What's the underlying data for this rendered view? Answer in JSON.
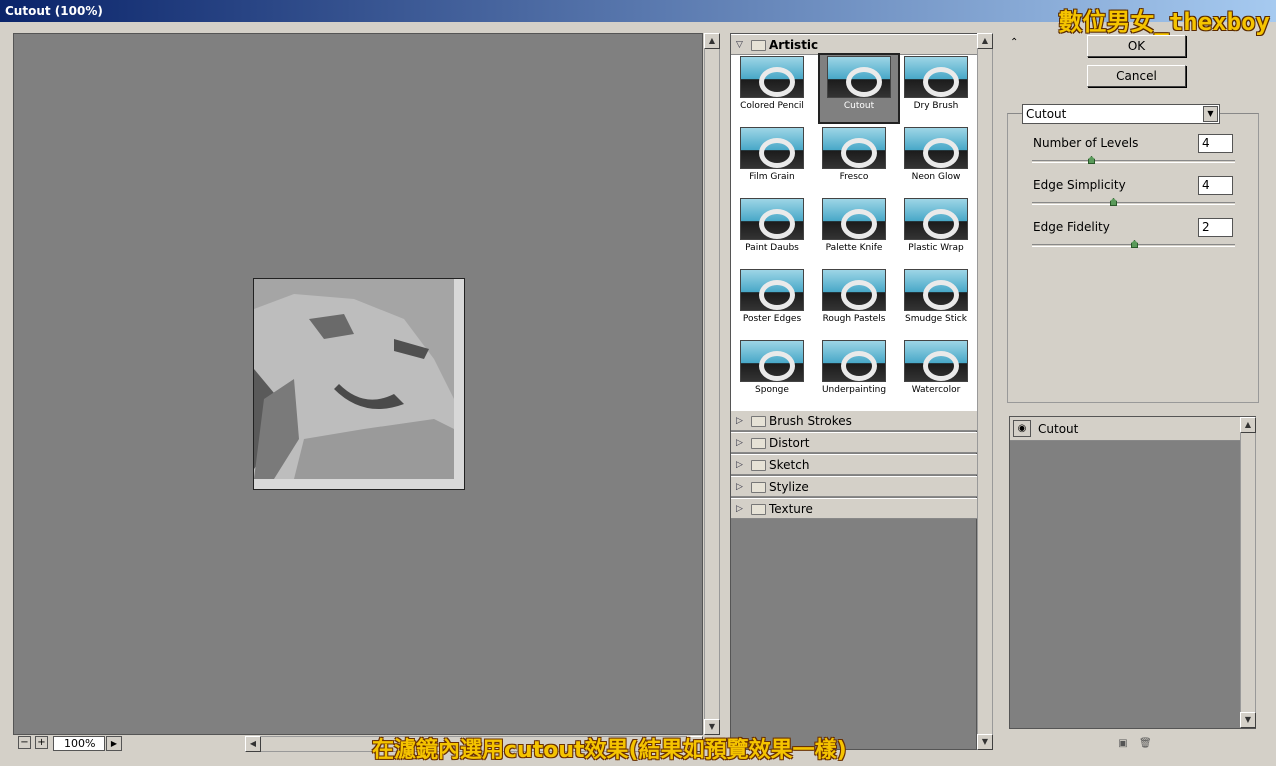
{
  "window": {
    "title": "Cutout (100%)"
  },
  "watermark": "數位男女_thexboy",
  "caption": "在濾鏡內選用cutout效果(結果如預覽效果一樣)",
  "preview": {
    "zoom": "100%",
    "zoom_out": "−",
    "zoom_in": "+"
  },
  "gallery": {
    "open_category": "Artistic",
    "filters": [
      {
        "label": "Colored Pencil"
      },
      {
        "label": "Cutout",
        "selected": true
      },
      {
        "label": "Dry Brush"
      },
      {
        "label": "Film Grain"
      },
      {
        "label": "Fresco"
      },
      {
        "label": "Neon Glow"
      },
      {
        "label": "Paint Daubs"
      },
      {
        "label": "Palette Knife"
      },
      {
        "label": "Plastic Wrap"
      },
      {
        "label": "Poster Edges"
      },
      {
        "label": "Rough Pastels"
      },
      {
        "label": "Smudge Stick"
      },
      {
        "label": "Sponge"
      },
      {
        "label": "Underpainting"
      },
      {
        "label": "Watercolor"
      }
    ],
    "categories": [
      "Brush Strokes",
      "Distort",
      "Sketch",
      "Stylize",
      "Texture"
    ]
  },
  "buttons": {
    "ok": "OK",
    "cancel": "Cancel"
  },
  "settings": {
    "filter": "Cutout",
    "params": [
      {
        "label": "Number of Levels",
        "value": "4",
        "level": 0.29
      },
      {
        "label": "Edge Simplicity",
        "value": "4",
        "level": 0.4
      },
      {
        "label": "Edge Fidelity",
        "value": "2",
        "level": 0.5
      }
    ]
  },
  "layers": {
    "items": [
      "Cutout"
    ]
  }
}
